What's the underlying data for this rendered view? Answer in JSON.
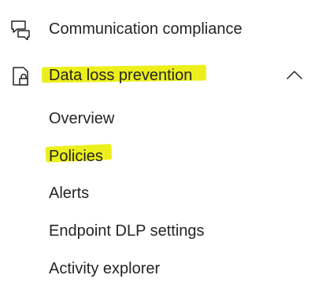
{
  "navigation": {
    "communication_compliance": {
      "label": "Communication compliance",
      "icon": "chat-bubbles-icon"
    },
    "data_loss_prevention": {
      "label": "Data loss prevention",
      "icon": "document-lock-icon",
      "expanded": true,
      "expand_icon": "chevron-up-icon",
      "highlight_color": "#ecef1c",
      "children": [
        {
          "label": "Overview"
        },
        {
          "label": "Policies"
        },
        {
          "label": "Alerts"
        },
        {
          "label": "Endpoint DLP settings"
        },
        {
          "label": "Activity explorer"
        }
      ]
    }
  }
}
